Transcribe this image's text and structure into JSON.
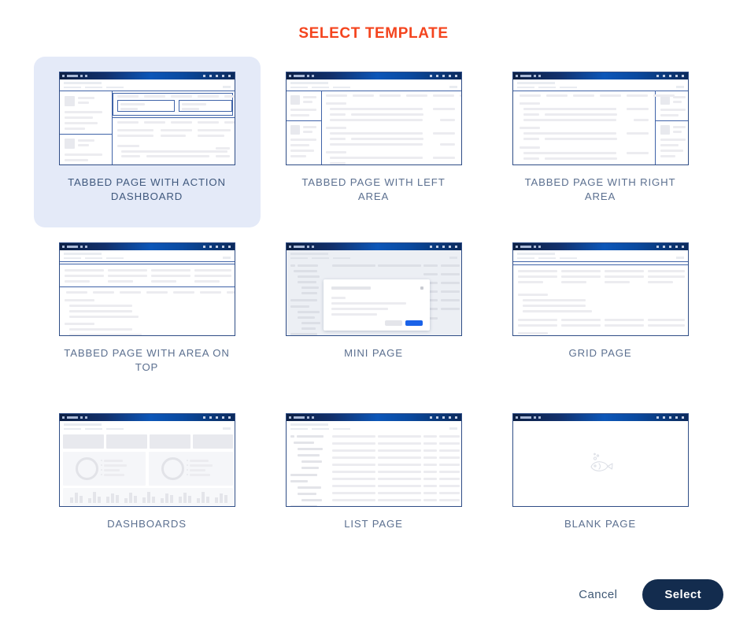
{
  "dialog": {
    "title": "SELECT TEMPLATE",
    "accent_color": "#f4441e",
    "selected_card_bg": "#e4eaf8",
    "label_color": "#5c7090"
  },
  "templates": [
    {
      "id": "tabbed-page-with-action-dashboard",
      "label": "TABBED PAGE WITH ACTION DASHBOARD",
      "selected": true,
      "thumb": "action-dashboard"
    },
    {
      "id": "tabbed-page-with-left-area",
      "label": "TABBED PAGE WITH LEFT AREA",
      "selected": false,
      "thumb": "left-area"
    },
    {
      "id": "tabbed-page-with-right-area",
      "label": "TABBED PAGE WITH RIGHT AREA",
      "selected": false,
      "thumb": "right-area"
    },
    {
      "id": "tabbed-page-with-area-on-top",
      "label": "TABBED PAGE WITH AREA ON TOP",
      "selected": false,
      "thumb": "area-on-top"
    },
    {
      "id": "mini-page",
      "label": "MINI PAGE",
      "selected": false,
      "thumb": "mini-page"
    },
    {
      "id": "grid-page",
      "label": "GRID PAGE",
      "selected": false,
      "thumb": "grid-page"
    },
    {
      "id": "dashboards",
      "label": "DASHBOARDS",
      "selected": false,
      "thumb": "dashboards"
    },
    {
      "id": "list-page",
      "label": "LIST PAGE",
      "selected": false,
      "thumb": "list-page"
    },
    {
      "id": "blank-page",
      "label": "BLANK PAGE",
      "selected": false,
      "thumb": "blank-page"
    }
  ],
  "footer": {
    "cancel_label": "Cancel",
    "select_label": "Select",
    "select_bg": "#132c4e"
  }
}
